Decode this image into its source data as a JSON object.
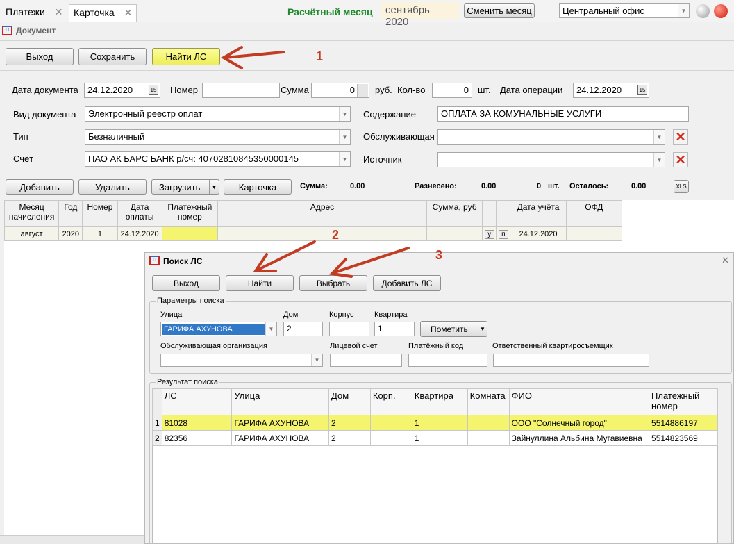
{
  "tabs": [
    {
      "label": "Платежи"
    },
    {
      "label": "Карточка"
    }
  ],
  "header": {
    "month_label": "Расчётный месяц",
    "month_value": "сентябрь 2020",
    "change_month": "Сменить месяц",
    "office": "Центральный офис"
  },
  "doc_title": "Документ",
  "toolbar": {
    "exit": "Выход",
    "save": "Сохранить",
    "find_ls": "Найти ЛС"
  },
  "form": {
    "doc_date_label": "Дата документа",
    "doc_date": "24.12.2020",
    "number_label": "Номер",
    "number": "",
    "sum_label": "Сумма",
    "sum": "0",
    "rub": "руб.",
    "qty_label": "Кол-во",
    "qty": "0",
    "pcs": "шт.",
    "op_date_label": "Дата операции",
    "op_date": "24.12.2020",
    "doc_type_label": "Вид документа",
    "doc_type": "Электронный реестр оплат",
    "content_label": "Содержание",
    "content": "ОПЛАТА ЗА КОМУНАЛЬНЫЕ УСЛУГИ",
    "type_label": "Тип",
    "type": "Безналичный",
    "serving_label": "Обслуживающая",
    "serving": "",
    "account_label": "Счёт",
    "account": "ПАО  АК БАРС  БАНК  р/сч: 40702810845350000145",
    "source_label": "Источник",
    "source": ""
  },
  "toolbar2": {
    "add": "Добавить",
    "delete": "Удалить",
    "load": "Загрузить",
    "card": "Карточка",
    "sum_label": "Сумма:",
    "sum": "0.00",
    "distributed_label": "Разнесено:",
    "distributed": "0.00",
    "count": "0",
    "pcs": "шт.",
    "remain_label": "Осталось:",
    "remain": "0.00",
    "xls": "XLS"
  },
  "grid": {
    "headers": [
      "Месяц начисления",
      "Год",
      "Номер",
      "Дата оплаты",
      "Платежный номер",
      "Адрес",
      "Сумма, руб",
      "",
      "",
      "Дата учёта",
      "ОФД"
    ],
    "rows": [
      [
        "август",
        "2020",
        "1",
        "24.12.2020",
        "",
        "",
        "",
        "у",
        "п",
        "24.12.2020",
        ""
      ]
    ]
  },
  "dialog": {
    "title": "Поиск ЛС",
    "exit": "Выход",
    "find": "Найти",
    "select": "Выбрать",
    "add_ls": "Добавить ЛС",
    "params_label": "Параметры поиска",
    "street_label": "Улица",
    "street": "ГАРИФА АХУНОВА",
    "house_label": "Дом",
    "house": "2",
    "korpus_label": "Корпус",
    "korpus": "",
    "flat_label": "Квартира",
    "flat": "1",
    "mark": "Пометить",
    "org_label": "Обслуживающая организация",
    "org": "",
    "account_label": "Лицевой счет",
    "account": "",
    "paycode_label": "Платёжный код",
    "paycode": "",
    "tenant_label": "Ответственный квартиросъемщик",
    "tenant": "",
    "result_label": "Результат поиска",
    "headers": [
      "ЛС",
      "Улица",
      "Дом",
      "Корп.",
      "Квартира",
      "Комната",
      "ФИО",
      "Платежный номер"
    ],
    "rows": [
      {
        "n": "1",
        "cells": [
          "81028",
          "ГАРИФА АХУНОВА",
          "2",
          "",
          "1",
          "",
          "ООО \"Солнечный город\"",
          "5514886197"
        ]
      },
      {
        "n": "2",
        "cells": [
          "82356",
          "ГАРИФА АХУНОВА",
          "2",
          "",
          "1",
          "",
          "Зайнуллина Альбина Мугавиевна",
          "5514823569"
        ]
      }
    ]
  },
  "annotations": [
    "1",
    "2",
    "3"
  ],
  "colors": {
    "highlight": "#f4f46e",
    "accent_green": "#1e8a2b",
    "arrow": "#c23b22",
    "selected": "#3178c6"
  }
}
